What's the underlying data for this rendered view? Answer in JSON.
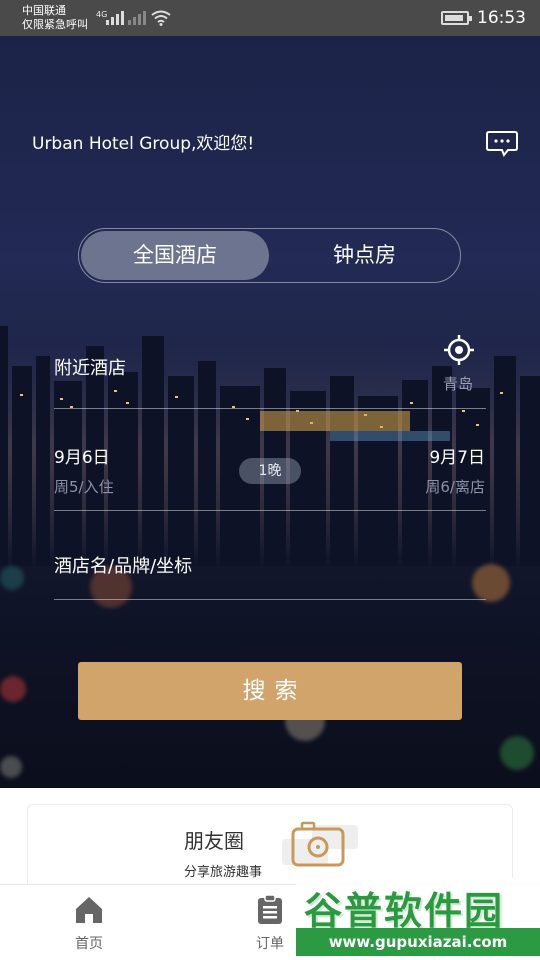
{
  "status_bar": {
    "carrier_line1": "中国联通",
    "carrier_line2": "仅限紧急呼叫",
    "network": "4G",
    "time": "16:53"
  },
  "header": {
    "welcome": "Urban Hotel Group,欢迎您!",
    "message_icon": "chat-bubble-icon"
  },
  "tabs": {
    "active": "全国酒店",
    "inactive": "钟点房"
  },
  "location": {
    "label": "附近酒店",
    "city": "青岛",
    "icon": "locate-target-icon"
  },
  "dates": {
    "checkin": "9月6日",
    "checkin_sub": "周5/入住",
    "nights": "1晚",
    "checkout": "9月7日",
    "checkout_sub": "周6/离店"
  },
  "keyword": {
    "placeholder": "酒店名/品牌/坐标"
  },
  "search_button": "搜索",
  "card": {
    "title": "朋友圈",
    "subtitle": "分享旅游趣事",
    "icon": "camera-icon"
  },
  "tab_bar": [
    {
      "label": "首页",
      "icon": "home-icon"
    },
    {
      "label": "订单",
      "icon": "clipboard-icon"
    }
  ],
  "watermark": {
    "title": "谷普软件园",
    "url": "www.gupuxiazai.com"
  },
  "colors": {
    "accent": "#d0a46a",
    "hero_bg": "#1c2348",
    "tab_active_bg": "#6d7490"
  }
}
